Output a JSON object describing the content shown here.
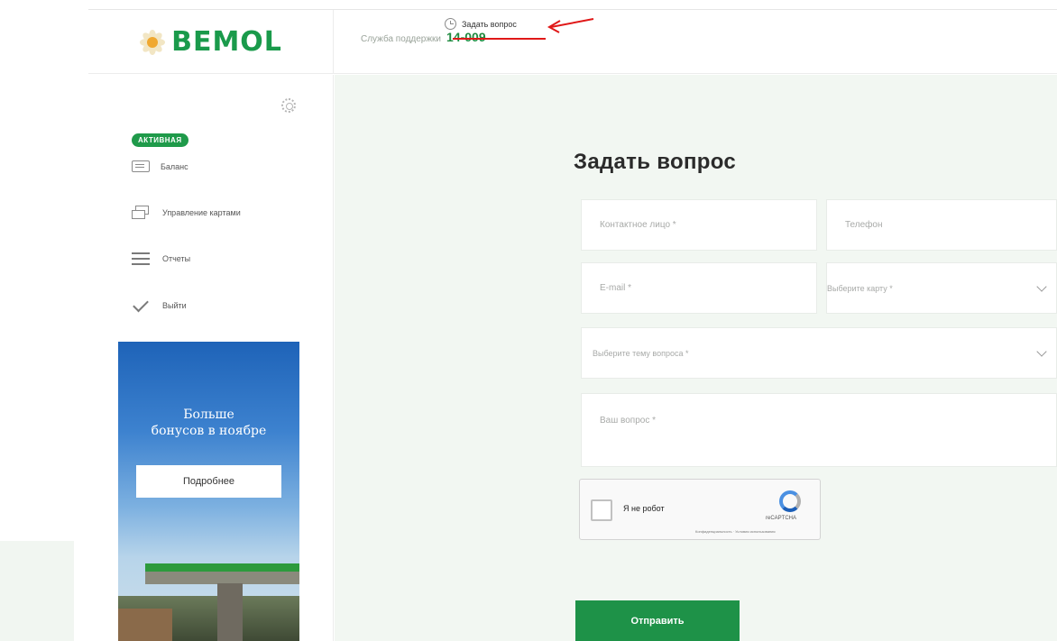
{
  "header": {
    "logo_text": "BEMOL",
    "support_label": "Служба поддержки",
    "support_phone": "14-009",
    "ask_link": "Задать вопрос"
  },
  "sidebar": {
    "status_badge": "АКТИВНАЯ",
    "items": [
      {
        "label": "Баланс",
        "icon": "balance-icon"
      },
      {
        "label": "Управление картами",
        "icon": "cards-icon"
      },
      {
        "label": "Отчеты",
        "icon": "reports-icon"
      },
      {
        "label": "Выйти",
        "icon": "check-icon"
      }
    ],
    "promo": {
      "line1": "Больше",
      "line2": "бонусов в ноябре",
      "button": "Подробнее"
    }
  },
  "form": {
    "title": "Задать вопрос",
    "contact_placeholder": "Контактное лицо *",
    "phone_placeholder": "Телефон",
    "email_placeholder": "E-mail *",
    "card_select": "Выберите карту *",
    "topic_select": "Выберите тему вопроса *",
    "question_placeholder": "Ваш вопрос *",
    "captcha": {
      "label": "Я не робот",
      "brand": "reCAPTCHA",
      "terms": "Конфиденциальность · Условия использования"
    },
    "submit": "Отправить"
  },
  "colors": {
    "brand_green": "#1e9248",
    "annotation_red": "#e01818",
    "background": "#f2f7f2"
  }
}
